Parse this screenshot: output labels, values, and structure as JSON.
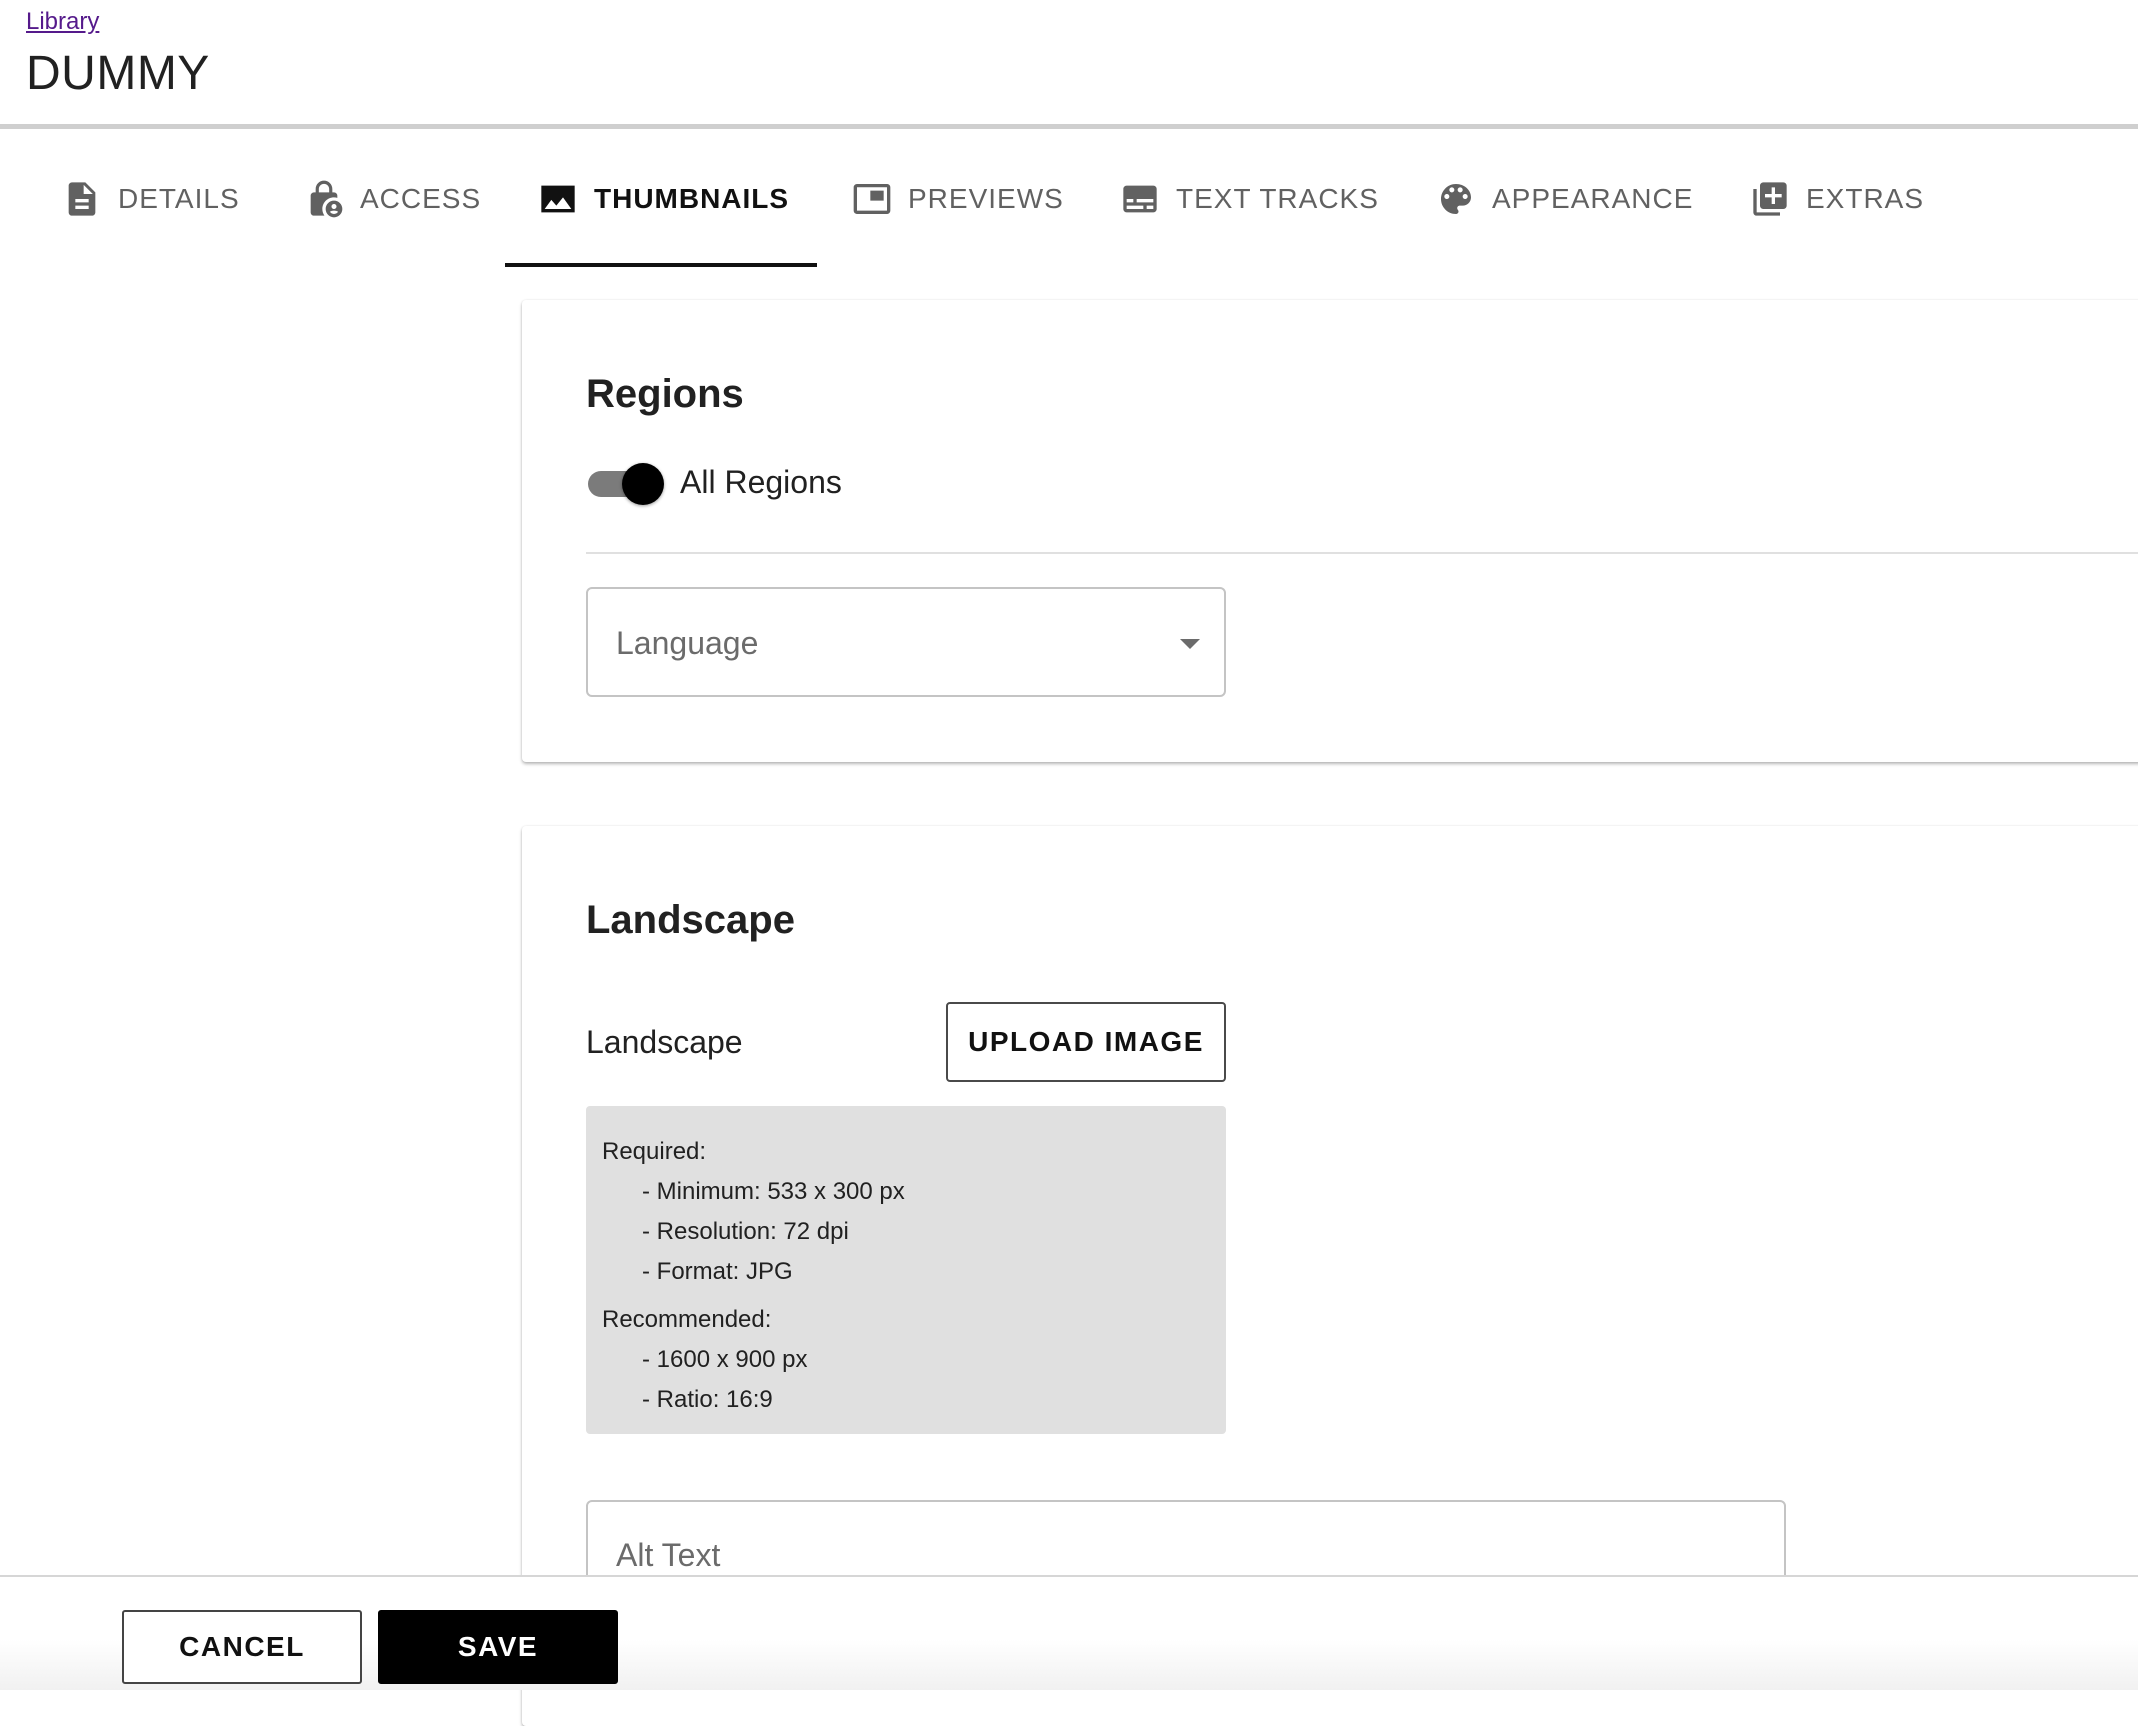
{
  "header": {
    "breadcrumb": "Library",
    "title": "DUMMY"
  },
  "tabs": [
    {
      "label": "DETAILS",
      "icon": "document-icon",
      "active": false
    },
    {
      "label": "ACCESS",
      "icon": "lock-person-icon",
      "active": false
    },
    {
      "label": "THUMBNAILS",
      "icon": "image-icon",
      "active": true
    },
    {
      "label": "PREVIEWS",
      "icon": "picture-in-picture-icon",
      "active": false
    },
    {
      "label": "TEXT TRACKS",
      "icon": "subtitles-icon",
      "active": false
    },
    {
      "label": "APPEARANCE",
      "icon": "palette-icon",
      "active": false
    },
    {
      "label": "EXTRAS",
      "icon": "library-add-icon",
      "active": false
    }
  ],
  "regions": {
    "title": "Regions",
    "toggle_label": "All Regions",
    "toggle_on": true,
    "language_placeholder": "Language"
  },
  "landscape": {
    "title": "Landscape",
    "field_label": "Landscape",
    "upload_label": "UPLOAD IMAGE",
    "requirements": {
      "required_header": "Required:",
      "required_items": [
        "- Minimum: 533 x 300 px",
        "- Resolution: 72 dpi",
        "- Format: JPG"
      ],
      "recommended_header": "Recommended:",
      "recommended_items": [
        "- 1600 x 900 px",
        "- Ratio: 16:9"
      ]
    },
    "alt_text_placeholder": "Alt Text"
  },
  "footer": {
    "cancel_label": "CANCEL",
    "save_label": "SAVE"
  },
  "colors": {
    "accent": "#000000",
    "tab_inactive": "#616161",
    "requirements_bg": "#e0e0e0"
  }
}
